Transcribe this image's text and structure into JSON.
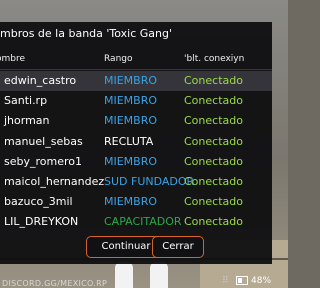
{
  "dialog": {
    "title": "mbros de la banda 'Toxic Gang'",
    "headers": {
      "name": "ombre",
      "rank": "Rango",
      "connection": "'blt. conexiyn"
    },
    "members": [
      {
        "name": "edwin_castro",
        "rank": "MIEMBRO",
        "status": "Conectado"
      },
      {
        "name": "Santi.rp",
        "rank": "MIEMBRO",
        "status": "Conectado"
      },
      {
        "name": "jhorman",
        "rank": "MIEMBRO",
        "status": "Conectado"
      },
      {
        "name": "manuel_sebas",
        "rank": "RECLUTA",
        "status": "Conectado"
      },
      {
        "name": "seby_romero1",
        "rank": "MIEMBRO",
        "status": "Conectado"
      },
      {
        "name": "maicol_hernandez",
        "rank": "SUD FUNDADOR",
        "status": "Conectado"
      },
      {
        "name": "bazuco_3mil",
        "rank": "MIEMBRO",
        "status": "Conectado"
      },
      {
        "name": "LIL_DREYKON",
        "rank": "CAPACITADOR",
        "status": "Conectado"
      }
    ],
    "continue_label": "Continuar",
    "close_label": "Cerrar"
  },
  "hud": {
    "left_text": "DISCORD.GG/MEXICO.RP",
    "battery_percent": "48%"
  },
  "colors": {
    "rank_member": "#3aa2e6",
    "rank_recruit": "#ffffff",
    "rank_trainer": "#2aa84a",
    "status_connected": "#9ad94a",
    "button_border": "#d9612b"
  }
}
